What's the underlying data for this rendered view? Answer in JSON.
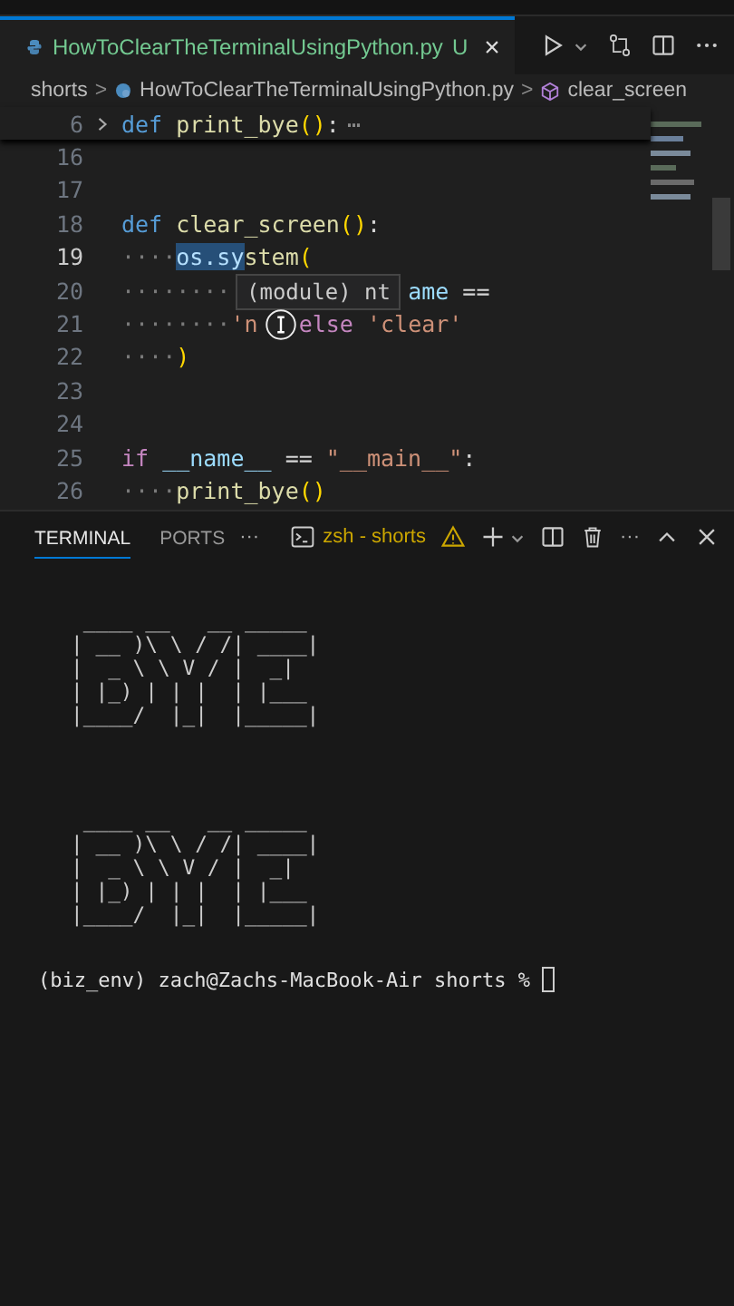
{
  "editor_tab": {
    "filename": "HowToClearTheTerminalUsingPython.py",
    "status": "U",
    "close": "×",
    "selected": true
  },
  "breadcrumbs": {
    "folder": "shorts",
    "separator": ">",
    "file": "HowToClearTheTerminalUsingPython.py",
    "symbol": "clear_screen"
  },
  "sticky_line": {
    "number": "6",
    "tokens": [
      {
        "text": "def ",
        "kind": "keyword"
      },
      {
        "text": "print_bye",
        "kind": "func"
      },
      {
        "text": "()",
        "kind": "paren"
      },
      {
        "text": ":",
        "kind": "plain"
      }
    ],
    "folded": "⋯"
  },
  "code_lines": [
    {
      "number": "16",
      "current": false
    },
    {
      "number": "17",
      "current": false
    },
    {
      "number": "18",
      "current": false,
      "tokens": [
        {
          "text": "def ",
          "kind": "keyword"
        },
        {
          "text": "clear_screen",
          "kind": "func"
        },
        {
          "text": "()",
          "kind": "paren"
        },
        {
          "text": ":",
          "kind": "plain"
        }
      ]
    },
    {
      "number": "19",
      "current": true,
      "tokens": [
        {
          "text": "····",
          "kind": "ws"
        },
        {
          "text": "os.sy",
          "kind": "var",
          "highlighted": true
        },
        {
          "text": "stem",
          "kind": "func"
        },
        {
          "text": "(",
          "kind": "paren"
        }
      ]
    },
    {
      "number": "20",
      "current": false,
      "tokens": [
        {
          "text": "········",
          "kind": "ws"
        },
        {
          "text": "             ame",
          "kind": "var"
        },
        {
          "text": " ==",
          "kind": "plain"
        }
      ]
    },
    {
      "number": "21",
      "current": false,
      "tokens": [
        {
          "text": "········",
          "kind": "ws"
        },
        {
          "text": "'n",
          "kind": "string"
        },
        {
          "text": "   else ",
          "kind": "control"
        },
        {
          "text": "'clear'",
          "kind": "string"
        }
      ]
    },
    {
      "number": "22",
      "current": false,
      "tokens": [
        {
          "text": "····",
          "kind": "ws"
        },
        {
          "text": ")",
          "kind": "paren"
        }
      ]
    },
    {
      "number": "23",
      "current": false
    },
    {
      "number": "24",
      "current": false
    },
    {
      "number": "25",
      "current": false,
      "tokens": [
        {
          "text": "if ",
          "kind": "control"
        },
        {
          "text": "__name__",
          "kind": "var"
        },
        {
          "text": " == ",
          "kind": "plain"
        },
        {
          "text": "\"__main__\"",
          "kind": "string"
        },
        {
          "text": ":",
          "kind": "plain"
        }
      ]
    },
    {
      "number": "26",
      "current": false,
      "tokens": [
        {
          "text": "····",
          "kind": "ws"
        },
        {
          "text": "print_bye",
          "kind": "func"
        },
        {
          "text": "()",
          "kind": "paren"
        }
      ]
    }
  ],
  "hover_tooltip": "(module) nt",
  "panel": {
    "tabs": [
      {
        "label": "TERMINAL",
        "selected": true
      },
      {
        "label": "PORTS",
        "selected": false
      }
    ],
    "more": "···",
    "terminal_name": "zsh - shorts",
    "actions_more": "···"
  },
  "terminal_output": [
    {
      "kind": "ascii_art",
      "lines": [
        " ____ __   __ _____ ",
        "| __ )\\ \\ / /| ____|",
        "|  _ \\ \\ V / |  _|  ",
        "| |_) | | |  | |___ ",
        "|____/  |_|  |_____|"
      ]
    },
    {
      "kind": "ascii_art",
      "lines": [
        " ____ __   __ _____ ",
        "| __ )\\ \\ / /| ____|",
        "|  _ \\ \\ V / |  _|  ",
        "| |_) | | |  | |___ ",
        "|____/  |_|  |_____|"
      ]
    },
    {
      "kind": "prompt",
      "text": "(biz_env) zach@Zachs-MacBook-Air shorts % "
    }
  ]
}
